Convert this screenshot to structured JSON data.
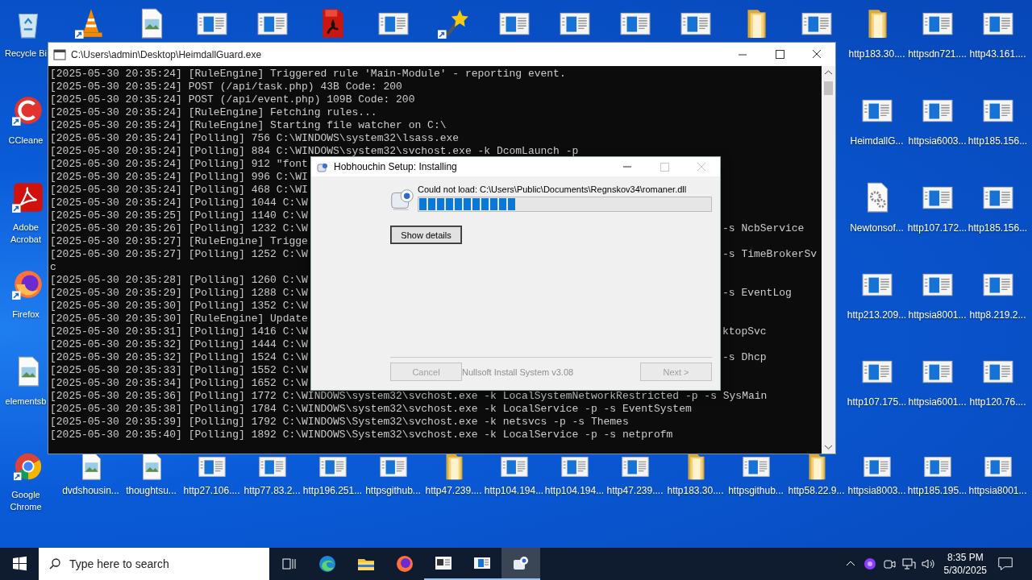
{
  "desktop": {
    "top_row": [
      {
        "kind": "recycle",
        "shortcut": false,
        "label": "Recycle Bi"
      },
      {
        "kind": "vlc",
        "shortcut": true
      },
      {
        "kind": "image",
        "shortcut": false
      },
      {
        "kind": "window",
        "shortcut": false
      },
      {
        "kind": "window",
        "shortcut": false
      },
      {
        "kind": "pdf",
        "shortcut": false
      },
      {
        "kind": "window",
        "shortcut": false
      },
      {
        "kind": "wand",
        "shortcut": true
      },
      {
        "kind": "window",
        "shortcut": false
      },
      {
        "kind": "window",
        "shortcut": false
      },
      {
        "kind": "window",
        "shortcut": false
      },
      {
        "kind": "window",
        "shortcut": false
      },
      {
        "kind": "folder",
        "shortcut": false
      },
      {
        "kind": "window",
        "shortcut": false
      },
      {
        "kind": "folder",
        "shortcut": false,
        "label": "http183.30...."
      },
      {
        "kind": "window",
        "shortcut": false,
        "label": "httpsdn721...."
      },
      {
        "kind": "window",
        "shortcut": false,
        "label": "http43.161...."
      }
    ],
    "left_column": [
      {
        "kind": "ccleaner",
        "shortcut": true,
        "label": "CCleane"
      },
      {
        "kind": "acrobat",
        "shortcut": true,
        "label": "Adobe Acrobat"
      },
      {
        "kind": "firefox",
        "shortcut": true,
        "label": "Firefox"
      },
      {
        "kind": "image",
        "shortcut": false,
        "label": "elementsb"
      }
    ],
    "right_rows": [
      [
        {
          "kind": "window",
          "shortcut": false,
          "label": "HeimdallG..."
        },
        {
          "kind": "window",
          "shortcut": false,
          "label": "httpsia6003..."
        },
        {
          "kind": "window",
          "shortcut": false,
          "label": "http185.156..."
        }
      ],
      [
        {
          "kind": "gear",
          "shortcut": false,
          "label": "Newtonsof..."
        },
        {
          "kind": "window",
          "shortcut": false,
          "label": "http107.172..."
        },
        {
          "kind": "window",
          "shortcut": false,
          "label": "http185.156..."
        }
      ],
      [
        {
          "kind": "window",
          "shortcut": false,
          "label": "http213.209..."
        },
        {
          "kind": "window",
          "shortcut": false,
          "label": "httpsia8001..."
        },
        {
          "kind": "window",
          "shortcut": false,
          "label": "http8.219.2..."
        }
      ],
      [
        {
          "kind": "window",
          "shortcut": false,
          "label": "http107.175..."
        },
        {
          "kind": "window",
          "shortcut": false,
          "label": "httpsia6001..."
        },
        {
          "kind": "window",
          "shortcut": false,
          "label": "http120.76...."
        }
      ]
    ],
    "bottom_row": [
      {
        "kind": "chrome",
        "shortcut": true,
        "label": "Google Chrome"
      },
      {
        "kind": "image",
        "shortcut": false,
        "label": "dvdshousin..."
      },
      {
        "kind": "image",
        "shortcut": false,
        "label": "thoughtsu..."
      },
      {
        "kind": "window",
        "shortcut": false,
        "label": "http27.106...."
      },
      {
        "kind": "window",
        "shortcut": false,
        "label": "http77.83.2..."
      },
      {
        "kind": "window",
        "shortcut": false,
        "label": "http196.251..."
      },
      {
        "kind": "window",
        "shortcut": false,
        "label": "httpsgithub..."
      },
      {
        "kind": "folder",
        "shortcut": false,
        "label": "http47.239...."
      },
      {
        "kind": "window",
        "shortcut": false,
        "label": "http104.194..."
      },
      {
        "kind": "window",
        "shortcut": false,
        "label": "http104.194..."
      },
      {
        "kind": "window",
        "shortcut": false,
        "label": "http47.239...."
      },
      {
        "kind": "folder",
        "shortcut": false,
        "label": "http183.30...."
      },
      {
        "kind": "window",
        "shortcut": false,
        "label": "httpsgithub..."
      },
      {
        "kind": "folder",
        "shortcut": false,
        "label": "http58.22.9..."
      },
      {
        "kind": "window",
        "shortcut": false,
        "label": "httpsia8003..."
      },
      {
        "kind": "window",
        "shortcut": false,
        "label": "http185.195..."
      },
      {
        "kind": "window",
        "shortcut": false,
        "label": "httpsia8001..."
      }
    ]
  },
  "console": {
    "title": "C:\\Users\\admin\\Desktop\\HeimdallGuard.exe",
    "lines": [
      {
        "text": "[2025-05-30 20:35:24] [RuleEngine] Triggered rule 'Main-Module' - reporting event."
      },
      {
        "text": "[2025-05-30 20:35:24] POST (/api/task.php) 43B Code: 200"
      },
      {
        "text": "[2025-05-30 20:35:24] POST (/api/event.php) 109B Code: 200"
      },
      {
        "text": "[2025-05-30 20:35:24] [RuleEngine] Fetching rules..."
      },
      {
        "text": "[2025-05-30 20:35:24] [RuleEngine] Starting file watcher on C:\\"
      },
      {
        "text": "[2025-05-30 20:35:24] [Polling] 756 C:\\WINDOWS\\system32\\lsass.exe"
      },
      {
        "text": "[2025-05-30 20:35:24] [Polling] 884 C:\\WINDOWS\\system32\\svchost.exe -k DcomLaunch -p"
      },
      {
        "text": "[2025-05-30 20:35:24] [Polling] 912 \"font"
      },
      {
        "text": "[2025-05-30 20:35:24] [Polling] 996 C:\\WI"
      },
      {
        "text": "[2025-05-30 20:35:24] [Polling] 468 C:\\WI"
      },
      {
        "text": "[2025-05-30 20:35:24] [Polling] 1044 C:\\W"
      },
      {
        "text": "[2025-05-30 20:35:25] [Polling] 1140 C:\\W"
      },
      {
        "text": "[2025-05-30 20:35:26] [Polling] 1232 C:\\W",
        "right": "-s NcbService"
      },
      {
        "text": "[2025-05-30 20:35:27] [RuleEngine] Trigge"
      },
      {
        "text": "[2025-05-30 20:35:27] [Polling] 1252 C:\\W",
        "right": "-s TimeBrokerSv"
      },
      {
        "text": "c"
      },
      {
        "text": "[2025-05-30 20:35:28] [Polling] 1260 C:\\W"
      },
      {
        "text": "[2025-05-30 20:35:29] [Polling] 1288 C:\\W",
        "right": "-s EventLog"
      },
      {
        "text": "[2025-05-30 20:35:30] [Polling] 1352 C:\\W"
      },
      {
        "text": "[2025-05-30 20:35:30] [RuleEngine] Update"
      },
      {
        "text": "[2025-05-30 20:35:31] [Polling] 1416 C:\\W",
        "right": "ktopSvc"
      },
      {
        "text": "[2025-05-30 20:35:32] [Polling] 1444 C:\\W"
      },
      {
        "text": "[2025-05-30 20:35:32] [Polling] 1524 C:\\W",
        "right": "-s Dhcp"
      },
      {
        "text": "[2025-05-30 20:35:33] [Polling] 1552 C:\\W"
      },
      {
        "text": "[2025-05-30 20:35:34] [Polling] 1652 C:\\W"
      },
      {
        "text": "[2025-05-30 20:35:36] [Polling] 1772 C:\\WINDOWS\\system32\\svchost.exe -k LocalSystemNetworkRestricted -p -s SysMain"
      },
      {
        "text": "[2025-05-30 20:35:38] [Polling] 1784 C:\\WINDOWS\\system32\\svchost.exe -k LocalService -p -s EventSystem"
      },
      {
        "text": "[2025-05-30 20:35:39] [Polling] 1792 C:\\WINDOWS\\System32\\svchost.exe -k netsvcs -p -s Themes"
      },
      {
        "text": "[2025-05-30 20:35:40] [Polling] 1892 C:\\WINDOWS\\System32\\svchost.exe -k LocalService -p -s netprofm"
      }
    ]
  },
  "installer": {
    "title": "Hobhouchin Setup: Installing",
    "controls": [
      {
        "kind": "minimize",
        "disabled": false
      },
      {
        "kind": "maximize",
        "disabled": true
      },
      {
        "kind": "close",
        "disabled": true
      }
    ],
    "status": "Could not load: C:\\Users\\Public\\Documents\\Regnskov34\\romaner.dll",
    "progress": {
      "level": 0.33
    },
    "details_button": "Show details",
    "cancel_button": {
      "label": "Cancel",
      "disabled": true
    },
    "branding": "Nullsoft Install System v3.08",
    "next_button": {
      "label": "Next >",
      "disabled": true
    }
  },
  "taskbar": {
    "search": {
      "placeholder": "Type here to search"
    },
    "apps": [
      {
        "kind": "taskview",
        "running": false,
        "selected": false
      },
      {
        "kind": "edge",
        "running": false,
        "selected": false
      },
      {
        "kind": "explorer",
        "running": false,
        "selected": false
      },
      {
        "kind": "firefox",
        "running": false,
        "selected": false
      },
      {
        "kind": "console",
        "running": true,
        "selected": false
      },
      {
        "kind": "window",
        "running": true,
        "selected": false
      },
      {
        "kind": "installer",
        "running": true,
        "selected": true
      }
    ],
    "clock": {
      "time": "8:35 PM",
      "date": "5/30/2025"
    }
  }
}
